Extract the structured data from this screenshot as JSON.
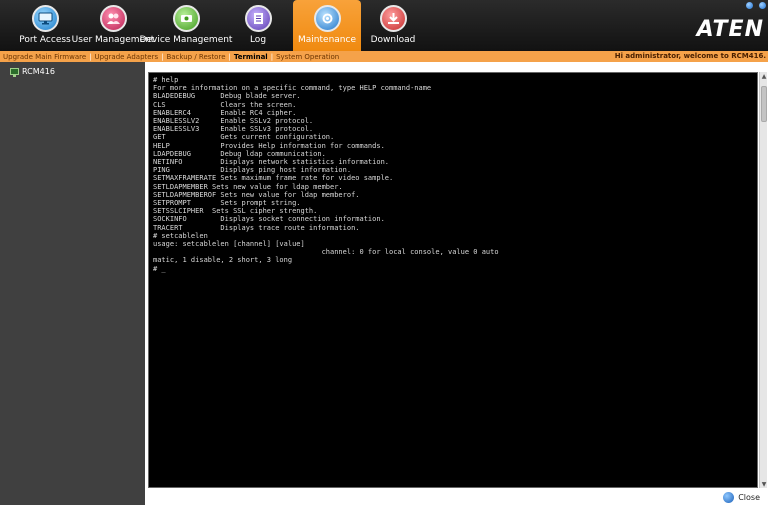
{
  "nav": {
    "items": [
      {
        "label": "Port Access",
        "icon": "monitor-icon",
        "active": false
      },
      {
        "label": "User Management",
        "icon": "users-icon",
        "active": false
      },
      {
        "label": "Device Management",
        "icon": "device-gear-icon",
        "active": false
      },
      {
        "label": "Log",
        "icon": "log-icon",
        "active": false
      },
      {
        "label": "Maintenance",
        "icon": "maintenance-icon",
        "active": true
      },
      {
        "label": "Download",
        "icon": "download-icon",
        "active": false
      }
    ],
    "logo": "ATEN"
  },
  "subnav": {
    "items": [
      {
        "label": "Upgrade Main Firmware"
      },
      {
        "label": "Upgrade Adapters"
      },
      {
        "label": "Backup / Restore"
      },
      {
        "label": "Terminal"
      },
      {
        "label": "System Operation"
      }
    ],
    "active_label": "Terminal",
    "welcome": "Hi administrator, welcome to RCM416."
  },
  "sidebar": {
    "tree": [
      {
        "label": "RCM416"
      }
    ]
  },
  "terminal": {
    "text": "# help\nFor more information on a specific command, type HELP command-name\nBLADEDEBUG      Debug blade server.\nCLS             Clears the screen.\nENABLERC4       Enable RC4 cipher.\nENABLESSLV2     Enable SSLv2 protocol.\nENABLESSLV3     Enable SSLv3 protocol.\nGET             Gets current configuration.\nHELP            Provides Help information for commands.\nLDAPDEBUG       Debug ldap communication.\nNETINFO         Displays network statistics information.\nPING            Displays ping host information.\nSETMAXFRAMERATE Sets maximum frame rate for video sample.\nSETLDAPMEMBER Sets new value for ldap member.\nSETLDAPMEMBEROF Sets new value for ldap memberof.\nSETPROMPT       Sets prompt string.\nSETSSLCIPHER  Sets SSL cipher strength.\nSOCKINFO        Displays socket connection information.\nTRACERT         Displays trace route information.\n# setcablelen\nusage: setcablelen [channel] [value]\n                                        channel: 0 for local console, value 0 auto\nmatic, 1 disable, 2 short, 3 long\n# _"
  },
  "footer": {
    "close_label": "Close"
  },
  "colors": {
    "accent": "#f5a24a",
    "nav_bg": "#1e1e1e",
    "sidebar_bg": "#404040",
    "terminal_bg": "#000000"
  }
}
